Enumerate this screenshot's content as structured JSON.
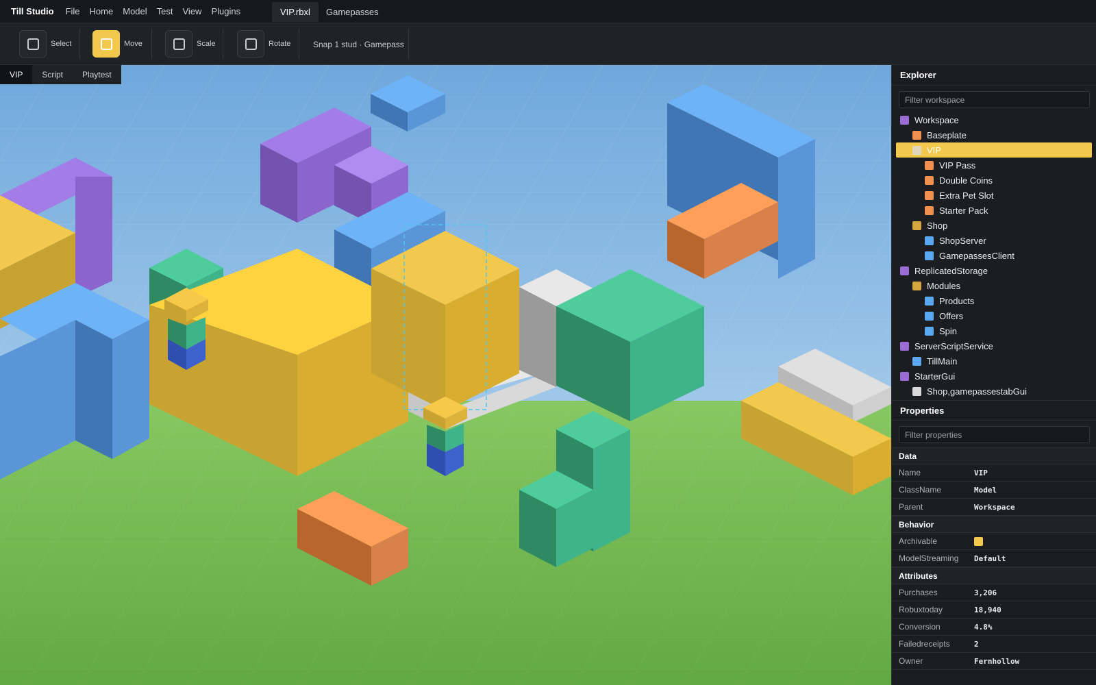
{
  "app": {
    "title": "Till Studio"
  },
  "menu": [
    "File",
    "Home",
    "Model",
    "Test",
    "View",
    "Plugins"
  ],
  "file_tabs": [
    {
      "label": "VIP.rbxl",
      "active": true
    },
    {
      "label": "Gamepasses",
      "active": false
    }
  ],
  "toolbar": {
    "tools": [
      {
        "label": "Select",
        "active": false
      },
      {
        "label": "Move",
        "active": true
      },
      {
        "label": "Scale",
        "active": false
      },
      {
        "label": "Rotate",
        "active": false
      }
    ],
    "snap": "Snap 1 stud · Gamepass"
  },
  "viewport_tabs": [
    {
      "label": "VIP",
      "active": true
    },
    {
      "label": "Script",
      "active": false
    },
    {
      "label": "Playtest",
      "active": false
    }
  ],
  "explorer": {
    "title": "Explorer",
    "filter_placeholder": "Filter workspace",
    "items": [
      {
        "label": "Workspace",
        "color": "#9b6bd6",
        "depth": 0
      },
      {
        "label": "Baseplate",
        "color": "#f2914f",
        "depth": 1
      },
      {
        "label": "VIP",
        "color": "#d9d9d9",
        "depth": 1,
        "selected": true
      },
      {
        "label": "VIP Pass",
        "color": "#f2914f",
        "depth": 2
      },
      {
        "label": "Double Coins",
        "color": "#f2914f",
        "depth": 2
      },
      {
        "label": "Extra Pet Slot",
        "color": "#f2914f",
        "depth": 2
      },
      {
        "label": "Starter Pack",
        "color": "#f2914f",
        "depth": 2
      },
      {
        "label": "Shop",
        "color": "#d4a63d",
        "depth": 1
      },
      {
        "label": "ShopServer",
        "color": "#5aa7f2",
        "depth": 2
      },
      {
        "label": "GamepassesClient",
        "color": "#5aa7f2",
        "depth": 2
      },
      {
        "label": "ReplicatedStorage",
        "color": "#9b6bd6",
        "depth": 0
      },
      {
        "label": "Modules",
        "color": "#d4a63d",
        "depth": 1
      },
      {
        "label": "Products",
        "color": "#5aa7f2",
        "depth": 2
      },
      {
        "label": "Offers",
        "color": "#5aa7f2",
        "depth": 2
      },
      {
        "label": "Spin",
        "color": "#5aa7f2",
        "depth": 2
      },
      {
        "label": "ServerScriptService",
        "color": "#9b6bd6",
        "depth": 0
      },
      {
        "label": "TillMain",
        "color": "#5aa7f2",
        "depth": 1
      },
      {
        "label": "StarterGui",
        "color": "#9b6bd6",
        "depth": 0
      },
      {
        "label": "Shop,gamepassestabGui",
        "color": "#d9d9d9",
        "depth": 1
      }
    ]
  },
  "properties": {
    "title": "Properties",
    "filter_placeholder": "Filter properties",
    "sections": {
      "data": {
        "title": "Data",
        "rows": [
          {
            "key": "Name",
            "value": "VIP"
          },
          {
            "key": "ClassName",
            "value": "Model"
          },
          {
            "key": "Parent",
            "value": "Workspace"
          }
        ]
      },
      "behavior": {
        "title": "Behavior",
        "archivable_label": "Archivable",
        "archivable": true,
        "streaming_label": "ModelStreaming",
        "streaming_value": "Default"
      },
      "attributes": {
        "title": "Attributes",
        "rows": [
          {
            "key": "Purchases",
            "value": "3,206"
          },
          {
            "key": "Robuxtoday",
            "value": "18,940"
          },
          {
            "key": "Conversion",
            "value": "4.8%"
          },
          {
            "key": "Failedreceipts",
            "value": "2"
          },
          {
            "key": "Owner",
            "value": "Fernhollow"
          }
        ]
      }
    }
  },
  "colors": {
    "accent": "#f2c94c",
    "sky_top": "#6fa8dc",
    "ground": "#7cc15a",
    "yellow": "#f2c94c",
    "purple": "#a47ce8",
    "blue": "#5aa7f2",
    "green": "#3fb38a",
    "orange": "#f2914f",
    "gray": "#d9d9d9"
  }
}
